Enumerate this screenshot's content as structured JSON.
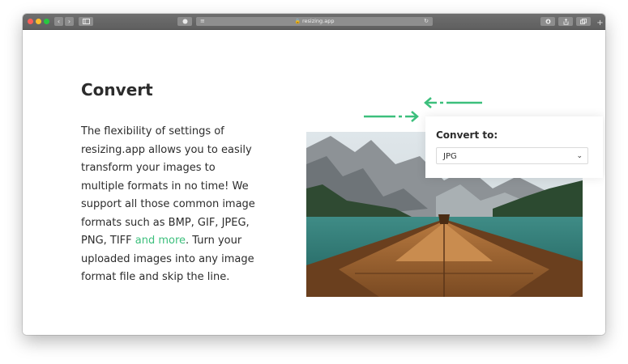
{
  "browser": {
    "url": "resizing.app",
    "icons": {
      "back": "chevron-left-icon",
      "forward": "chevron-right-icon",
      "sidebar": "sidebar-icon",
      "shield": "shield-icon",
      "reader": "reader-icon",
      "reload": "reload-icon",
      "download": "download-icon",
      "share": "share-icon",
      "tabs": "tabs-icon",
      "new_tab": "plus-icon"
    }
  },
  "section": {
    "title": "Convert",
    "paragraph_before_link": "The flexibility of settings of resizing.app allows you to easily transform your images to multiple formats in no time! We support all those common image formats such as BMP, GIF, JPEG, PNG, TIFF ",
    "link_text": "and more",
    "paragraph_after_link": ". Turn your uploaded images into any image format file and skip the line."
  },
  "converter": {
    "label": "Convert to:",
    "selected_format": "JPG"
  },
  "colors": {
    "accent": "#3cbf7c",
    "text": "#2c2c2c"
  }
}
